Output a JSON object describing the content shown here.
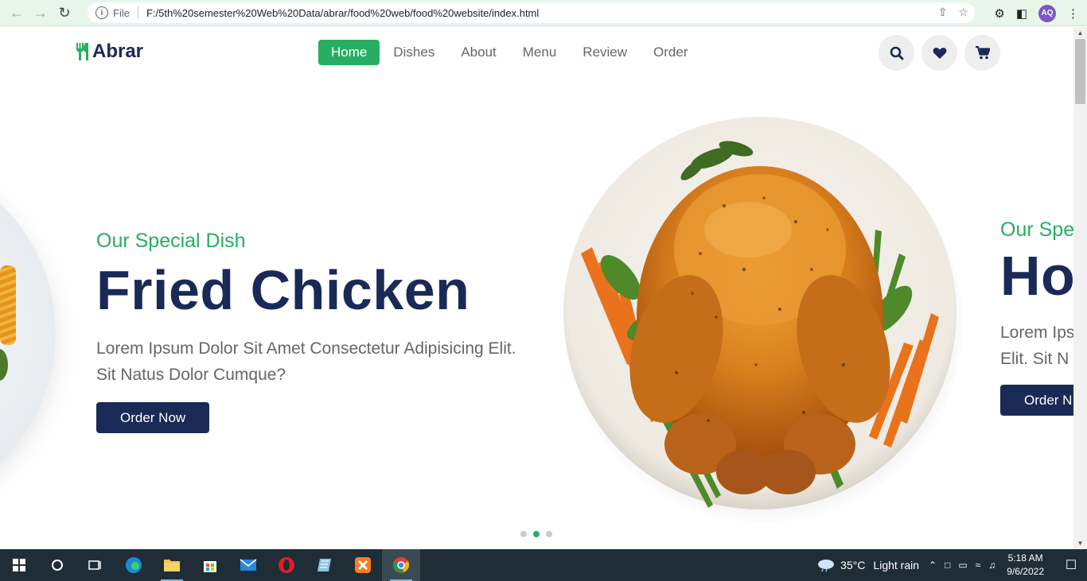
{
  "browser": {
    "url_prefix": "File",
    "url": "F:/5th%20semester%20Web%20Data/abrar/food%20web/food%20website/index.html",
    "profile_initials": "AQ"
  },
  "site": {
    "logo": "Abrar",
    "nav": [
      {
        "label": "Home",
        "active": true
      },
      {
        "label": "Dishes"
      },
      {
        "label": "About"
      },
      {
        "label": "Menu"
      },
      {
        "label": "Review"
      },
      {
        "label": "Order"
      }
    ],
    "header_icons": [
      "search-icon",
      "heart-icon",
      "cart-icon"
    ]
  },
  "slides": {
    "current": {
      "subtitle": "Our Special Dish",
      "title": "Fried Chicken",
      "description": "Lorem Ipsum Dolor Sit Amet Consectetur Adipisicing Elit. Sit Natus Dolor Cumque?",
      "button": "Order Now"
    },
    "next": {
      "subtitle": "Our Spe",
      "title": "Ho",
      "description_line1": "Lorem Ips",
      "description_line2": "Elit. Sit N",
      "button": "Order N"
    },
    "dots": [
      {
        "active": false
      },
      {
        "active": true
      },
      {
        "active": false
      }
    ]
  },
  "taskbar": {
    "weather_temp": "35°C",
    "weather_text": "Light rain",
    "time": "5:18 AM",
    "date": "9/6/2022"
  },
  "colors": {
    "brand_green": "#27ae60",
    "brand_navy": "#192a56",
    "text_gray": "#666666"
  }
}
